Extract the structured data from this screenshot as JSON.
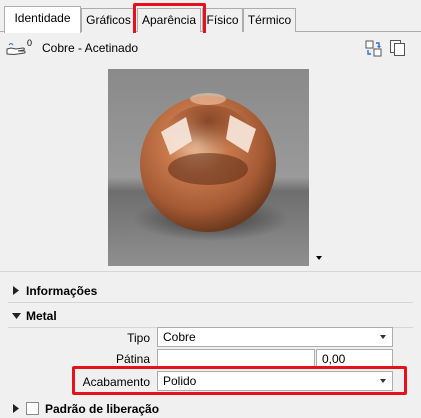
{
  "tabs": [
    {
      "label": "Identidade",
      "active": true
    },
    {
      "label": "Gráficos",
      "active": false
    },
    {
      "label": "Aparência",
      "active": false,
      "highlighted": true
    },
    {
      "label": "Físico",
      "active": false
    },
    {
      "label": "Térmico",
      "active": false
    }
  ],
  "material": {
    "name": "Cobre - Acetinado",
    "count": "0",
    "icons": [
      "hand-material-icon",
      "replace-icon",
      "duplicate-icon"
    ]
  },
  "preview": {
    "dropdown_icon": "triangle-down-icon"
  },
  "sections": {
    "informacoes": {
      "label": "Informações",
      "expanded": false
    },
    "metal": {
      "label": "Metal",
      "expanded": true
    },
    "padrao": {
      "label": "Padrão de liberação",
      "checked": false
    }
  },
  "properties": {
    "tipo": {
      "label": "Tipo",
      "value": "Cobre"
    },
    "patina": {
      "label": "Pátina",
      "value": "",
      "amount": "0,00"
    },
    "acabamento": {
      "label": "Acabamento",
      "value": "Polido",
      "highlighted": true
    }
  },
  "colors": {
    "highlight": "#e8101c",
    "copper": "#b4673f"
  }
}
